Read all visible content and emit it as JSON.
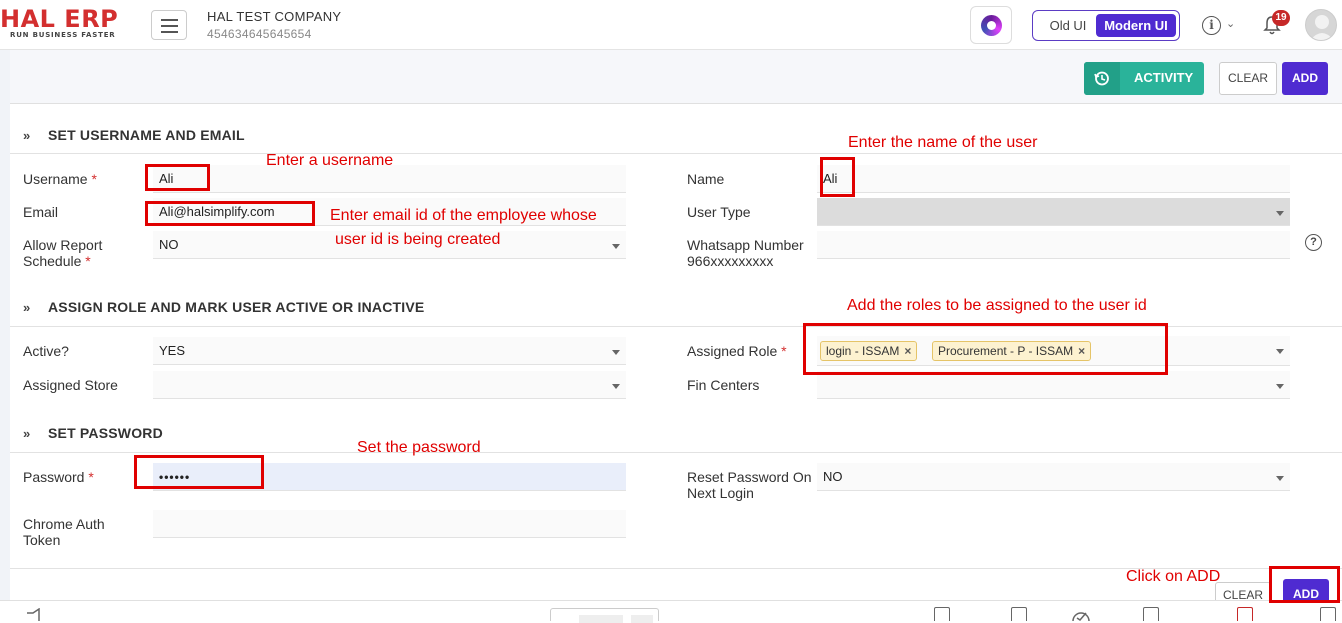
{
  "header": {
    "logo_main": "HAL ERP",
    "logo_tagline": "RUN BUSINESS FASTER",
    "company_name": "HAL TEST COMPANY",
    "company_id": "454634645645654",
    "ui_old": "Old UI",
    "ui_modern": "Modern UI",
    "notification_count": "19",
    "info_glyph": "i",
    "chevron_glyph": "⌄"
  },
  "toolbar": {
    "activity_label": "ACTIVITY",
    "clear_label": "CLEAR",
    "add_label": "ADD"
  },
  "sections": {
    "user": "SET USERNAME AND EMAIL",
    "role": "ASSIGN ROLE AND MARK USER ACTIVE OR INACTIVE",
    "password": "SET PASSWORD",
    "chev_glyph": "»"
  },
  "fields": {
    "username": {
      "label": "Username",
      "required": "*",
      "value": "Ali"
    },
    "name": {
      "label": "Name",
      "value": "Ali"
    },
    "email": {
      "label": "Email",
      "value": "Ali@halsimplify.com"
    },
    "user_type": {
      "label": "User Type",
      "value": ""
    },
    "allow_report_schedule": {
      "label_line1": "Allow Report",
      "label_line2": "Schedule",
      "required": "*",
      "value": "NO"
    },
    "whatsapp": {
      "label_line1": "Whatsapp Number",
      "label_line2": "966xxxxxxxxx",
      "value": ""
    },
    "active": {
      "label": "Active?",
      "value": "YES"
    },
    "assigned_role": {
      "label": "Assigned Role",
      "required": "*",
      "tags": [
        "login - ISSAM",
        "Procurement - P - ISSAM"
      ],
      "remove_glyph": "×"
    },
    "assigned_store": {
      "label": "Assigned Store",
      "value": ""
    },
    "fin_centers": {
      "label": "Fin Centers",
      "value": ""
    },
    "password": {
      "label": "Password",
      "required": "*",
      "value": "••••••"
    },
    "reset_password": {
      "label_line1": "Reset Password On",
      "label_line2": "Next Login",
      "value": "NO"
    },
    "chrome_token": {
      "label_line1": "Chrome Auth",
      "label_line2": "Token",
      "value": ""
    },
    "help_glyph": "?"
  },
  "annotations": {
    "username": "Enter a username",
    "name": "Enter the name of the user",
    "email_line1": "Enter email id of the employee whose",
    "email_line2": "user id is being created",
    "roles": "Add the roles to be assigned to the user id",
    "password": "Set the password",
    "add": "Click on ADD",
    "color": "#e00000"
  },
  "footer": {
    "clear_label": "CLEAR",
    "add_label": "ADD"
  },
  "colors": {
    "primary": "#4f2bd1",
    "activity": "#2ab39a",
    "brand_red": "#d32f2f"
  }
}
